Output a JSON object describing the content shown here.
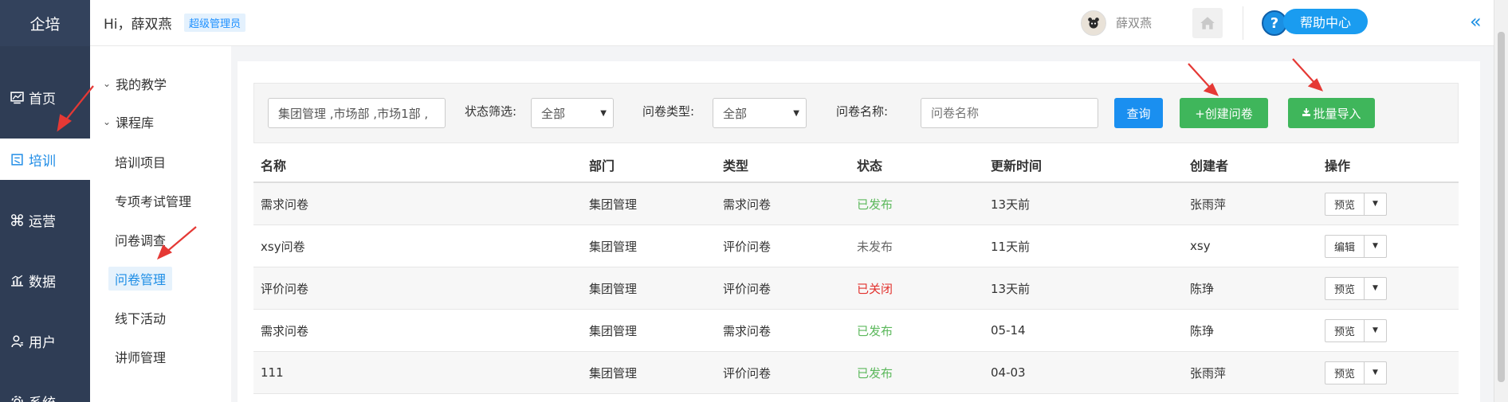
{
  "brand": "企培",
  "topbar": {
    "greeting": "Hi，薛双燕",
    "role_badge": "超级管理员",
    "username": "薛双燕",
    "help_label": "帮助中心",
    "help_glyph": "?",
    "collapse_glyph": "«"
  },
  "leftnav": {
    "items": [
      {
        "label": "首页",
        "icon": "dashboard-icon"
      },
      {
        "label": "培训",
        "icon": "training-icon",
        "active": true
      },
      {
        "label": "运营",
        "icon": "command-icon"
      },
      {
        "label": "数据",
        "icon": "chart-icon"
      },
      {
        "label": "用户",
        "icon": "user-icon"
      },
      {
        "label": "系统",
        "icon": "gear-icon"
      }
    ]
  },
  "subnav": {
    "my_teaching": "我的教学",
    "course_lib": "课程库",
    "items": [
      "培训项目",
      "专项考试管理",
      "问卷调查",
      "问卷管理",
      "线下活动",
      "讲师管理"
    ],
    "selected": "问卷管理"
  },
  "filters": {
    "dept_value": "集团管理 ,市场部 ,市场1部 ,",
    "status_label": "状态筛选:",
    "status_value": "全部",
    "type_label": "问卷类型:",
    "type_value": "全部",
    "name_label": "问卷名称:",
    "name_placeholder": "问卷名称",
    "query_label": "查询",
    "create_label": "+创建问卷",
    "import_label": "批量导入"
  },
  "table": {
    "headers": [
      "名称",
      "部门",
      "类型",
      "状态",
      "更新时间",
      "创建者",
      "操作"
    ],
    "rows": [
      {
        "name": "需求问卷",
        "dept": "集团管理",
        "type": "需求问卷",
        "status": "已发布",
        "status_color": "#5cb85c",
        "updated": "13天前",
        "creator": "张雨萍",
        "action": "预览"
      },
      {
        "name": "xsy问卷",
        "dept": "集团管理",
        "type": "评价问卷",
        "status": "未发布",
        "status_color": "#666666",
        "updated": "11天前",
        "creator": "xsy",
        "action": "编辑"
      },
      {
        "name": "评价问卷",
        "dept": "集团管理",
        "type": "评价问卷",
        "status": "已关闭",
        "status_color": "#e2312d",
        "updated": "13天前",
        "creator": "陈琤",
        "action": "预览"
      },
      {
        "name": "需求问卷",
        "dept": "集团管理",
        "type": "需求问卷",
        "status": "已发布",
        "status_color": "#5cb85c",
        "updated": "05-14",
        "creator": "陈琤",
        "action": "预览"
      },
      {
        "name": "111",
        "dept": "集团管理",
        "type": "评价问卷",
        "status": "已发布",
        "status_color": "#5cb85c",
        "updated": "04-03",
        "creator": "张雨萍",
        "action": "预览"
      }
    ]
  },
  "colors": {
    "nav_bg": "#2f3d55",
    "accent_blue": "#1a8ff0",
    "green": "#3fb65b",
    "annotation_red": "#e53935"
  }
}
